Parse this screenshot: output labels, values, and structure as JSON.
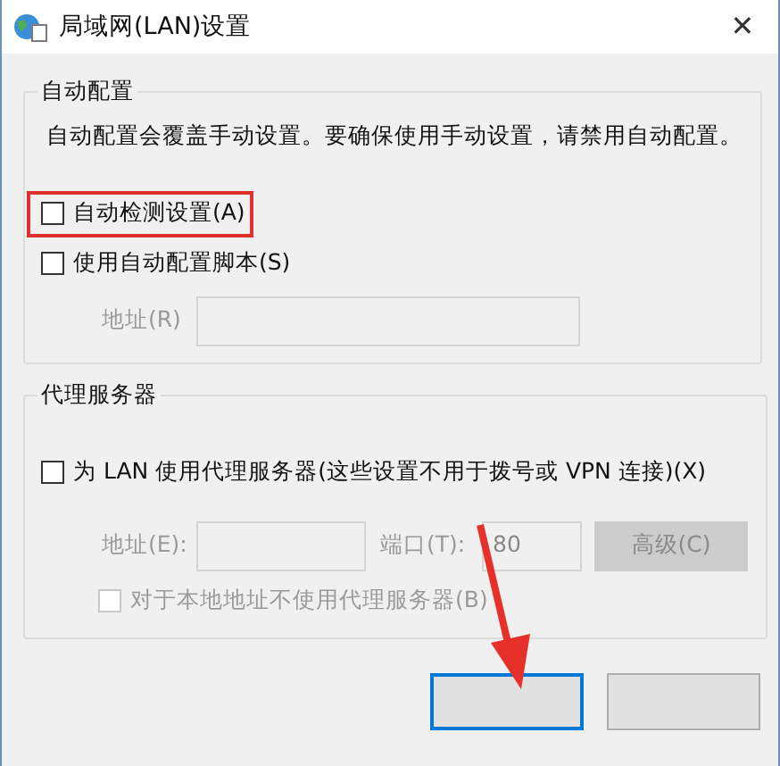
{
  "window": {
    "title": "局域网(LAN)设置",
    "close": "✕"
  },
  "auto_config": {
    "legend": "自动配置",
    "description": "自动配置会覆盖手动设置。要确保使用手动设置，请禁用自动配置。",
    "options": [
      {
        "label": "自动检测设置(A)",
        "checked": false,
        "highlighted": true
      },
      {
        "label": "使用自动配置脚本(S)",
        "checked": false,
        "highlighted": false
      }
    ],
    "address": {
      "label": "地址(R)",
      "disabled": true
    }
  },
  "proxy": {
    "legend": "代理服务器",
    "use_proxy": {
      "label": "为 LAN 使用代理服务器(这些设置不用于拨号或 VPN 连接)(X)",
      "checked": false
    },
    "address": {
      "label": "地址(E):",
      "disabled": true
    },
    "port": {
      "label": "端口(T):",
      "value": "80",
      "disabled": true
    },
    "advanced": {
      "label": "高级(C)",
      "disabled": true
    },
    "bypass": {
      "label": "对于本地地址不使用代理服务器(B)",
      "checked": false,
      "disabled": true
    }
  },
  "buttons": [
    {
      "kind": "default"
    },
    {
      "kind": "normal"
    }
  ]
}
